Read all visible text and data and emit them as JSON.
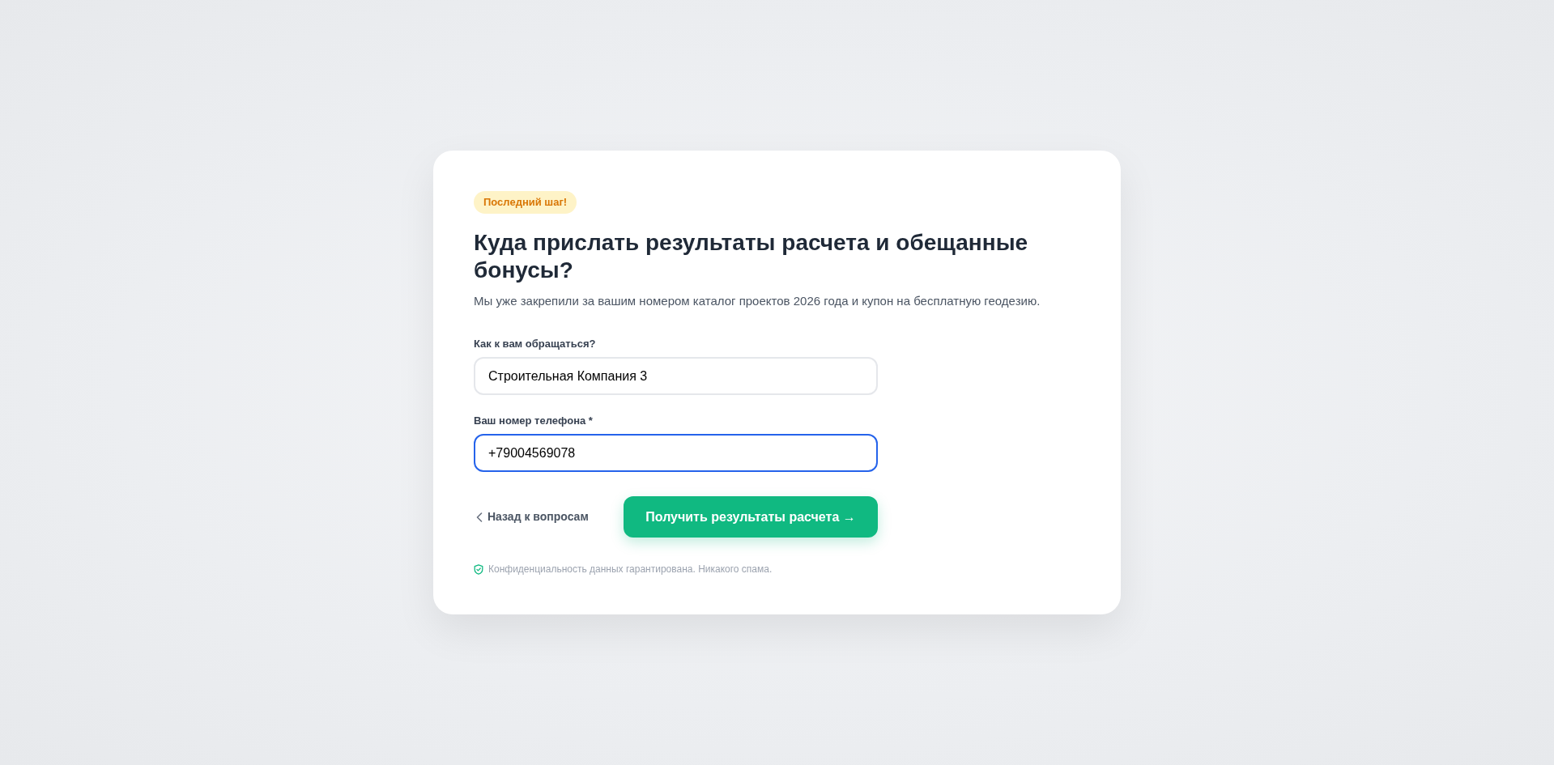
{
  "badge": {
    "text": "Последний шаг!"
  },
  "title": "Куда прислать результаты расчета и обещанные бонусы?",
  "subtitle": "Мы уже закрепили за вашим номером каталог проектов 2026 года и купон на бесплатную геодезию.",
  "fields": [
    {
      "label": "Как к вам обращаться?",
      "value": "Строительная Компания 3",
      "focused": false
    },
    {
      "label": "Ваш номер телефона *",
      "value": "+79004569078",
      "focused": true
    }
  ],
  "back_link": {
    "label": "Назад к вопросам"
  },
  "submit_button": {
    "label": "Получить результаты расчета →"
  },
  "privacy_note": "Конфиденциальность данных гарантирована. Никакого спама."
}
